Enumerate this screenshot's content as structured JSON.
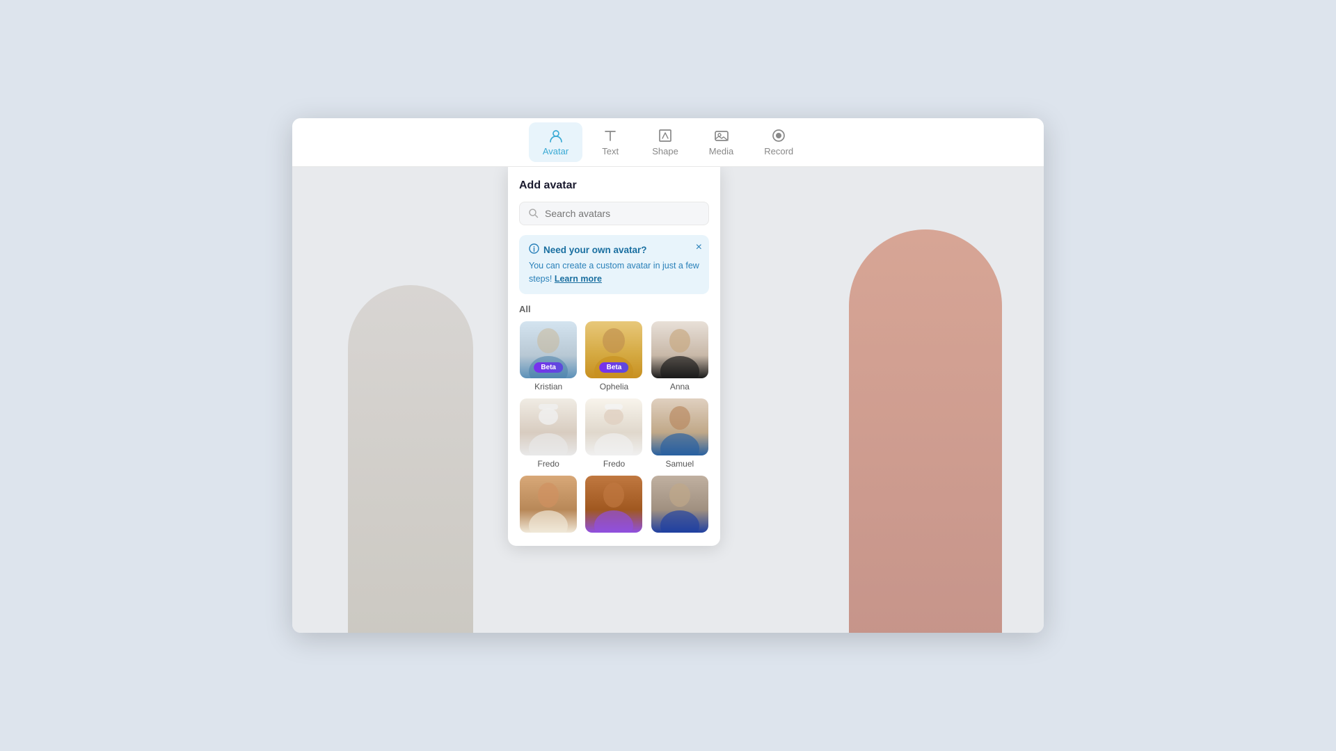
{
  "toolbar": {
    "tabs": [
      {
        "id": "avatar",
        "label": "Avatar",
        "icon": "avatar-icon",
        "active": true
      },
      {
        "id": "text",
        "label": "Text",
        "icon": "text-icon",
        "active": false
      },
      {
        "id": "shape",
        "label": "Shape",
        "icon": "shape-icon",
        "active": false
      },
      {
        "id": "media",
        "label": "Media",
        "icon": "media-icon",
        "active": false
      },
      {
        "id": "record",
        "label": "Record",
        "icon": "record-icon",
        "active": false
      }
    ]
  },
  "panel": {
    "title": "Add avatar",
    "search_placeholder": "Search avatars",
    "banner": {
      "title": "Need your own avatar?",
      "body": "You can create a custom avatar in just a few steps!",
      "link_text": "Learn more"
    },
    "section_label": "All",
    "avatars": [
      {
        "name": "Kristian",
        "beta": true,
        "style": "person-kristian"
      },
      {
        "name": "Ophelia",
        "beta": true,
        "style": "person-ophelia"
      },
      {
        "name": "Anna",
        "beta": false,
        "style": "person-anna"
      },
      {
        "name": "Fredo",
        "beta": false,
        "style": "person-fredo1"
      },
      {
        "name": "Fredo",
        "beta": false,
        "style": "person-fredo2"
      },
      {
        "name": "Samuel",
        "beta": false,
        "style": "person-samuel"
      },
      {
        "name": "",
        "beta": false,
        "style": "person-r1"
      },
      {
        "name": "",
        "beta": false,
        "style": "person-r2"
      },
      {
        "name": "",
        "beta": false,
        "style": "person-r3"
      }
    ]
  }
}
